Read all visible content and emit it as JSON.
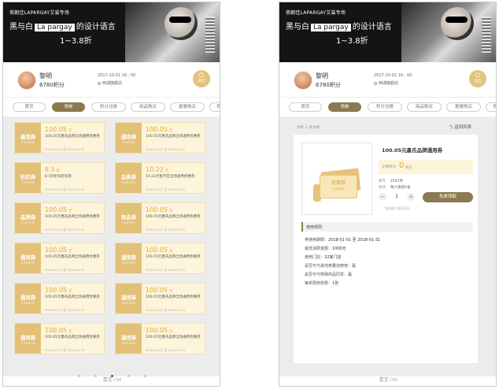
{
  "banner": {
    "small": "倘朝佳LAPARGAY艾装专场",
    "main_pre": "黑与白",
    "brand": "La pargay",
    "main_post": "的设计语言",
    "discount": "1~3.8折"
  },
  "profile": {
    "name": "黎明",
    "points": "6780积分",
    "time": "2017-10-01 16 : 00",
    "store": "西湖旗舰店",
    "exit_label": "退出",
    "exit_icon": "power-icon"
  },
  "tabs": [
    "首页",
    "领券",
    "积分兑换",
    "商品购买",
    "套餐购买",
    "积分"
  ],
  "active_tab": 1,
  "coupons": [
    {
      "type": "通用券",
      "sub": "COUPON",
      "amount": "100.05",
      "unit": "元",
      "desc": "100.05元墨氏品牌全场通用优惠券",
      "date": "2018-01-01 至 2018-01-31"
    },
    {
      "type": "通用券",
      "sub": "COUPON",
      "amount": "100.05",
      "unit": "元",
      "desc": "100.05元墨氏品牌全场通用优惠券",
      "date": "2018-01-01 至 2018-01-31"
    },
    {
      "type": "折扣券",
      "sub": "COUPON",
      "amount": "8.5",
      "unit": "折",
      "desc": "8.5元折扣折扣券",
      "date": "2018-01-01 至 2018-01-31"
    },
    {
      "type": "品类券",
      "sub": "COUPON",
      "amount": "10.22",
      "unit": "元",
      "desc": "10.22元框不宜全场通用优惠券",
      "date": "2018-01-01 至 2018-01-31"
    },
    {
      "type": "品牌券",
      "sub": "COUPON",
      "amount": "100.05",
      "unit": "元",
      "desc": "100.05元墨氏品牌全场通用优惠券",
      "date": "2018-01-01 至 2018-01-31"
    },
    {
      "type": "商品券",
      "sub": "COUPON",
      "amount": "100.05",
      "unit": "元",
      "desc": "100.05元墨氏品牌全场通用优惠券",
      "date": "2018-01-01 至 2018-01-31"
    },
    {
      "type": "通用券",
      "sub": "COUPON",
      "amount": "100.05",
      "unit": "元",
      "desc": "100.05元墨氏品牌全场通用优惠券",
      "date": "2018-01-01 至 2018-01-31"
    },
    {
      "type": "通用券",
      "sub": "COUPON",
      "amount": "100.05",
      "unit": "元",
      "desc": "100.05元墨氏品牌全场通用优惠券",
      "date": "2018-01-01 至 2018-01-31"
    },
    {
      "type": "通用券",
      "sub": "COUPON",
      "amount": "100.05",
      "unit": "元",
      "desc": "100.05元墨氏品牌全场通用优惠券",
      "date": "2018-01-01 至 2018-01-31"
    },
    {
      "type": "通用券",
      "sub": "COUPON",
      "amount": "100.05",
      "unit": "元",
      "desc": "100.05元墨氏品牌全场通用优惠券",
      "date": "2018-01-01 至 2018-01-31"
    },
    {
      "type": "通用券",
      "sub": "COUPON",
      "amount": "100.05",
      "unit": "元",
      "desc": "100.05元墨氏品牌全场通用优惠券",
      "date": "2018-01-01 至 2018-01-31"
    },
    {
      "type": "通用券",
      "sub": "COUPON",
      "amount": "100.05",
      "unit": "元",
      "desc": "100.05元墨氏品牌全场通用优惠券",
      "date": "2018-01-01 至 2018-01-31"
    }
  ],
  "pager": {
    "count": 5,
    "current": 2
  },
  "footer": {
    "brand": "喜宝",
    "suffix": "CRE"
  },
  "detail": {
    "breadcrumb": "领券 > 券详情",
    "back_label": "返回列表",
    "title": "100.05元墨氏品牌通用券",
    "price_label": "兑换积分",
    "price_value": "0",
    "price_unit": "积分",
    "stock_label": "库存",
    "stock_value": "2541件",
    "limit_label": "限领",
    "limit_value": "每人限领1张",
    "qty": "1",
    "claim_label": "免费领取",
    "rule_link": "您的账户暂无积分",
    "img_text": "优惠券",
    "img_sub": "COUPON",
    "rules_title": "使用规则",
    "rules": [
      {
        "k": "券使用期限：",
        "v": "2018-01-01 至 2018-01-31"
      },
      {
        "k": "最低消费金额：",
        "v": "1000元"
      },
      {
        "k": "使用门店：",
        "v": "32家门店"
      },
      {
        "k": "是否可与其他券叠加使用：",
        "v": "是"
      },
      {
        "k": "是否可与特殊商品同享：",
        "v": "是"
      },
      {
        "k": "每单限用张数：",
        "v": "1张"
      }
    ]
  }
}
